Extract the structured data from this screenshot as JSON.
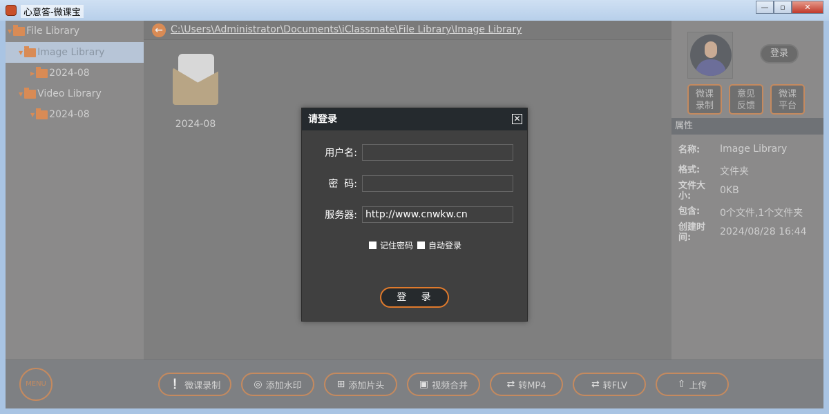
{
  "window": {
    "title": "心意答-微课宝",
    "min": "—",
    "max": "▫",
    "close": "✕"
  },
  "sidebar": {
    "items": [
      {
        "label": "File Library"
      },
      {
        "label": "Image Library"
      },
      {
        "label": "2024-08"
      },
      {
        "label": "Video Library"
      },
      {
        "label": "2024-08"
      }
    ]
  },
  "main": {
    "path": "C:\\Users\\Administrator\\Documents\\iClassmate\\File Library\\Image Library",
    "files": [
      {
        "name": "2024-08"
      }
    ]
  },
  "right": {
    "login": "登录",
    "quick": [
      [
        "微课",
        "录制"
      ],
      [
        "意见",
        "反馈"
      ],
      [
        "微课",
        "平台"
      ]
    ],
    "prop_title": "属性",
    "props": [
      {
        "label": "名称:",
        "value": "Image Library"
      },
      {
        "label": "格式:",
        "value": "文件夹"
      },
      {
        "label": "文件大小:",
        "value": "0KB"
      },
      {
        "label": "包含:",
        "value": "0个文件,1个文件夹"
      },
      {
        "label": "创建时间:",
        "value": "2024/08/28  16:44"
      }
    ]
  },
  "toolbar": {
    "menu": "MENU",
    "buttons": [
      {
        "label": "微课录制",
        "icon": "❕"
      },
      {
        "label": "添加水印",
        "icon": "◎"
      },
      {
        "label": "添加片头",
        "icon": "⊞"
      },
      {
        "label": "视频合并",
        "icon": "▣"
      },
      {
        "label": "转MP4",
        "icon": "⇄"
      },
      {
        "label": "转FLV",
        "icon": "⇄"
      },
      {
        "label": "上传",
        "icon": "⇧"
      }
    ]
  },
  "dialog": {
    "title": "请登录",
    "close": "✕",
    "username_label": "用户名:",
    "username": "",
    "password_label": "密  码:",
    "password": "",
    "server_label": "服务器:",
    "server": "http://www.cnwkw.cn",
    "remember": "记住密码",
    "auto": "自动登录",
    "login": "登   录"
  }
}
